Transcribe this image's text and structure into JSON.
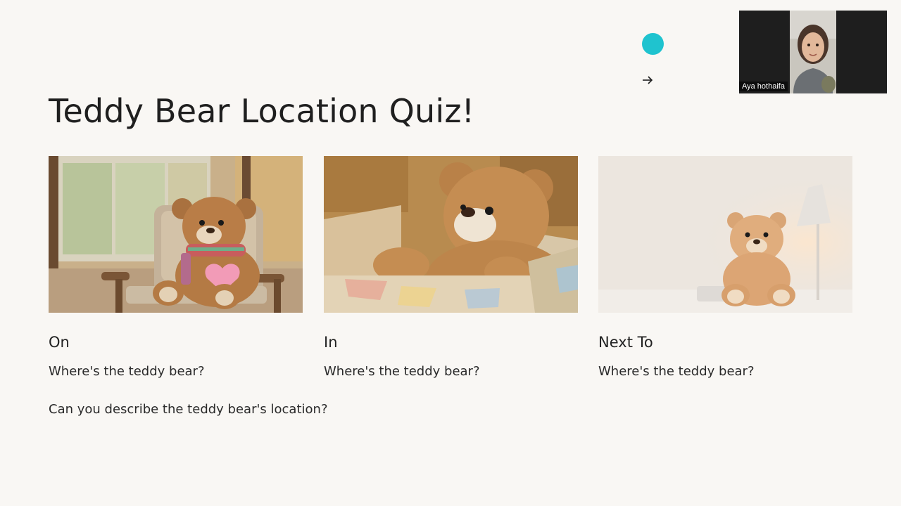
{
  "slide": {
    "title": "Teddy Bear Location Quiz!",
    "cards": [
      {
        "label": "On",
        "question": "Where's the teddy bear?",
        "image": "teddy bear sitting on a chair"
      },
      {
        "label": "In",
        "question": "Where's the teddy bear?",
        "image": "teddy bear inside a box"
      },
      {
        "label": "Next To",
        "question": "Where's the teddy bear?",
        "image": "teddy bear next to a lamp"
      }
    ],
    "bottom_question": "Can you describe the teddy bear's location?"
  },
  "pointer": {
    "color": "#1fc3cf",
    "icon": "arrow-right-icon"
  },
  "video": {
    "participant_name": "Aya hothaifa"
  }
}
